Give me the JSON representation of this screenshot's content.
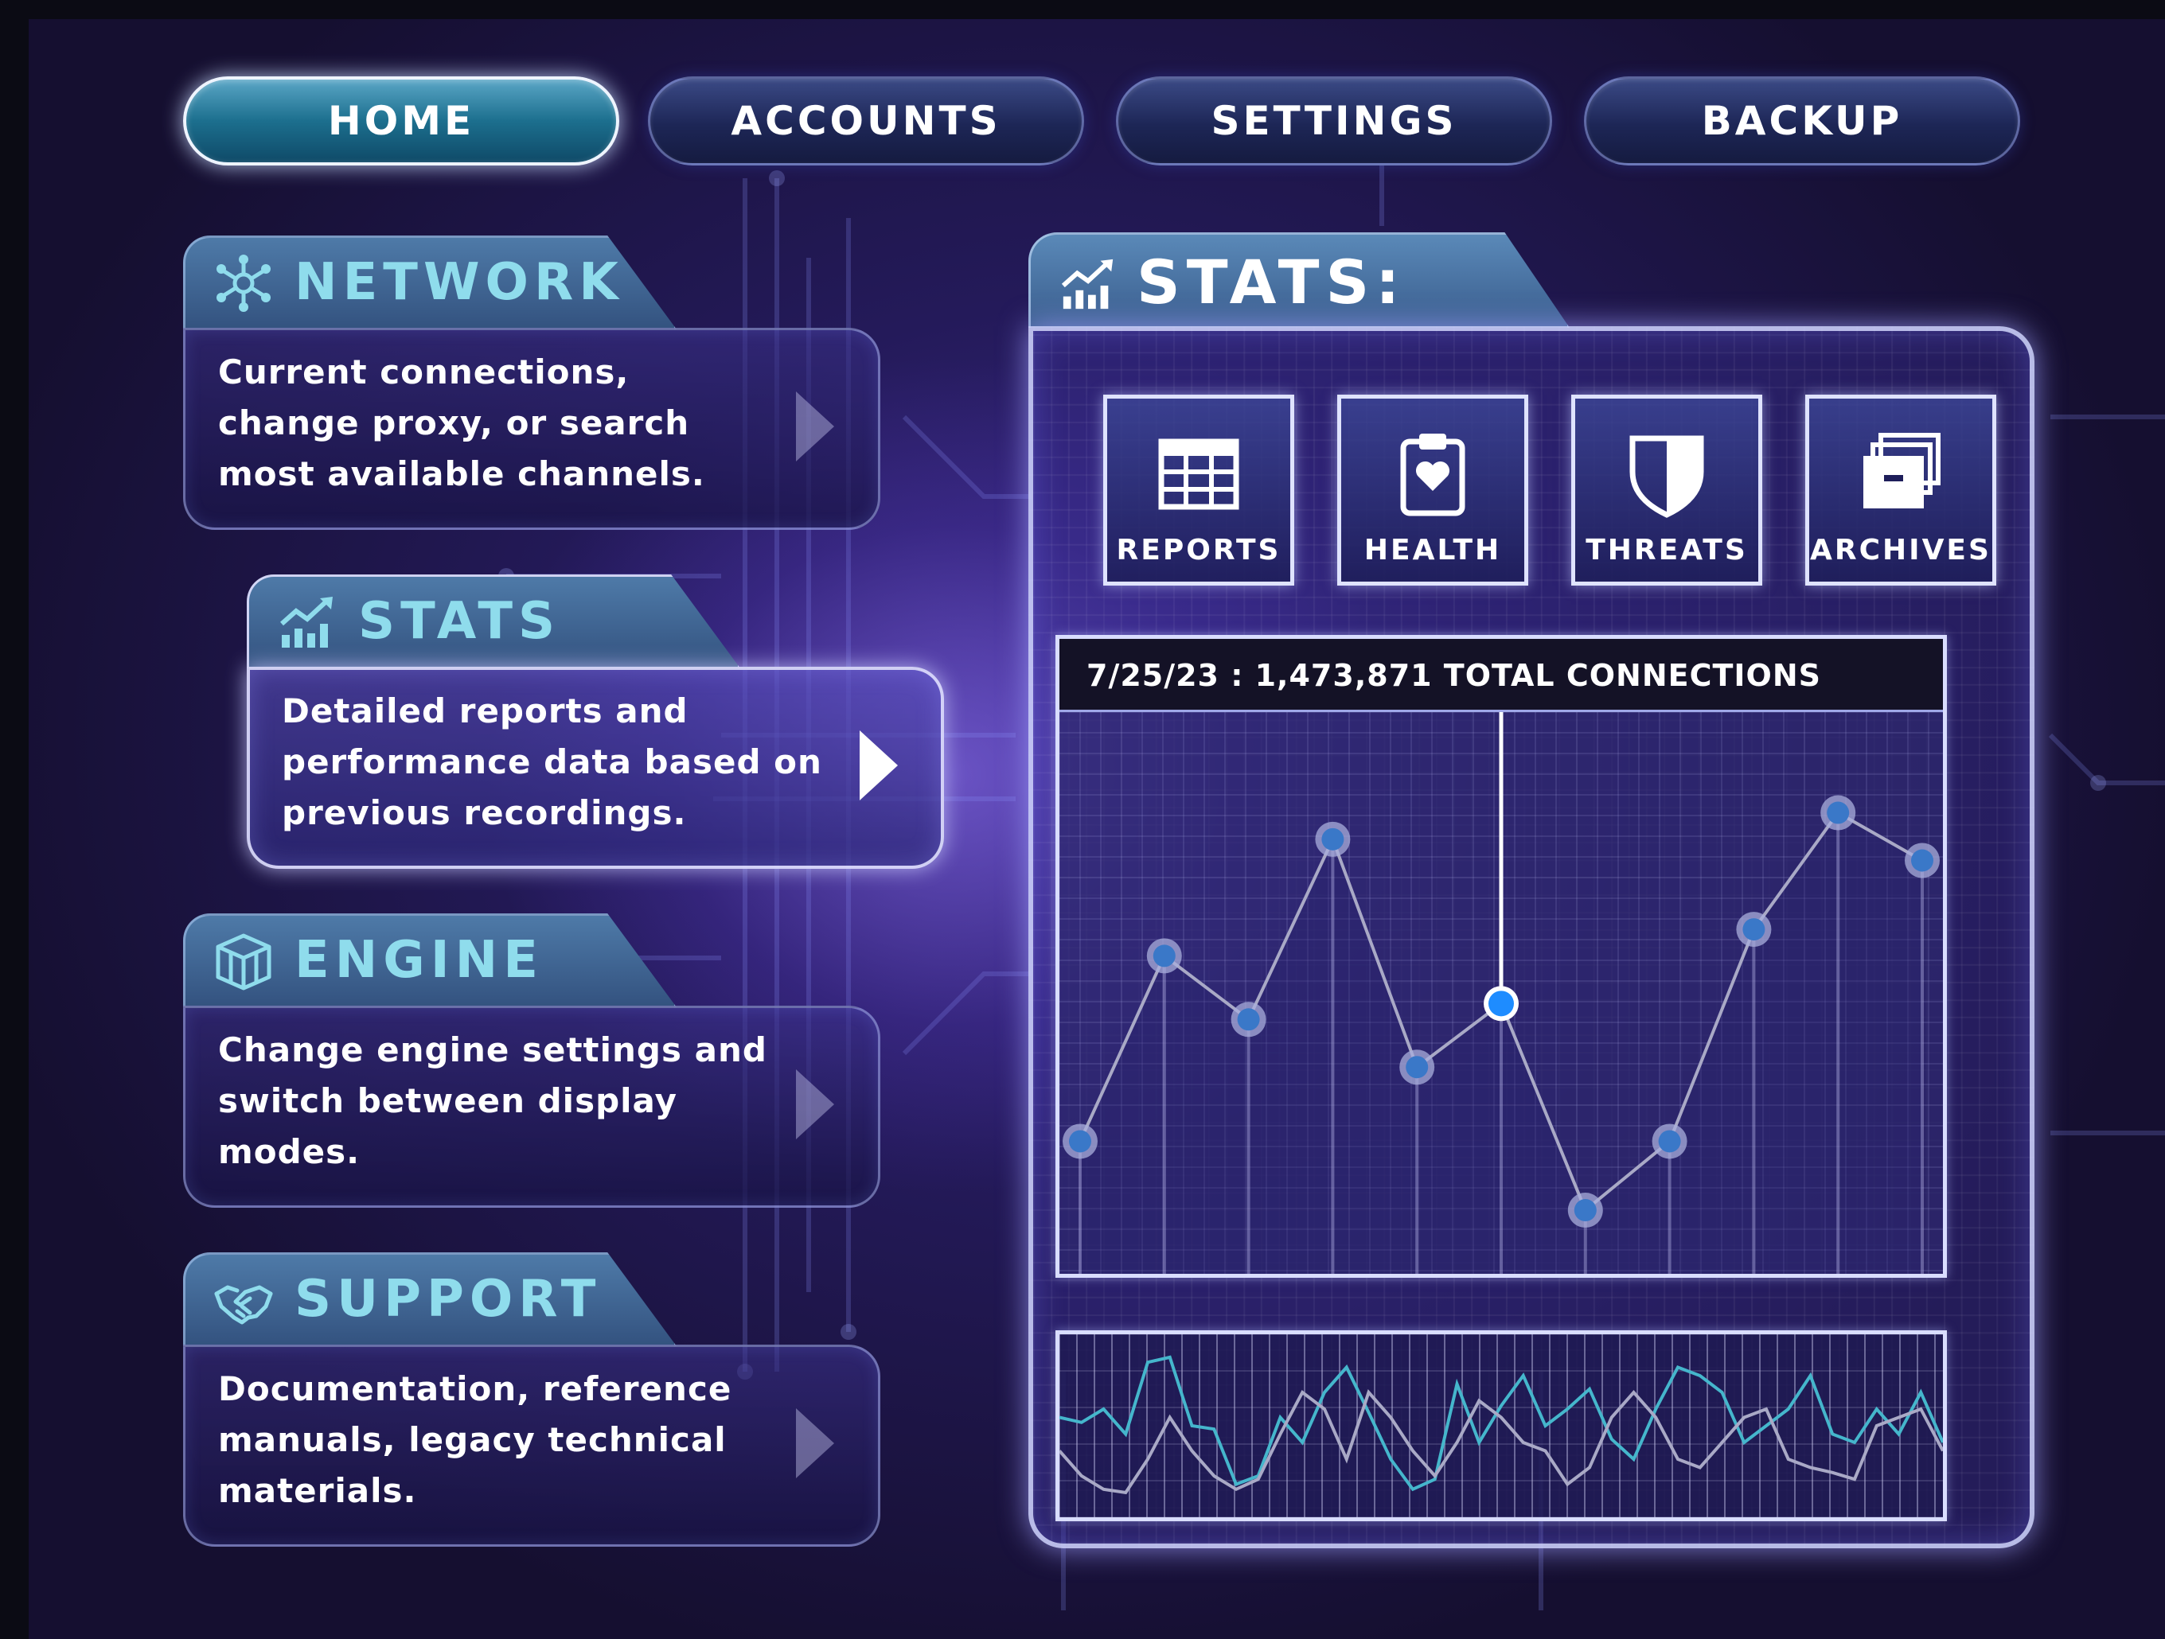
{
  "nav": {
    "tabs": [
      {
        "label": "HOME",
        "active": true
      },
      {
        "label": "ACCOUNTS",
        "active": false
      },
      {
        "label": "SETTINGS",
        "active": false
      },
      {
        "label": "BACKUP",
        "active": false
      }
    ]
  },
  "menu": {
    "network": {
      "title": "NETWORK",
      "description": "Current connections, change proxy, or search most available channels.",
      "icon": "network-icon"
    },
    "stats": {
      "title": "STATS",
      "description": "Detailed reports and performance data based on previous recordings.",
      "icon": "chart-growth-icon",
      "active": true
    },
    "engine": {
      "title": "ENGINE",
      "description": "Change engine settings and switch between display modes.",
      "icon": "engine-cube-icon"
    },
    "support": {
      "title": "SUPPORT",
      "description": "Documentation, reference manuals, legacy technical materials.",
      "icon": "handshake-icon"
    }
  },
  "stats_panel": {
    "title": "STATS:",
    "icon": "chart-growth-icon",
    "buttons": [
      {
        "label": "REPORTS",
        "icon": "table-grid-icon"
      },
      {
        "label": "HEALTH",
        "icon": "clipboard-heart-icon"
      },
      {
        "label": "THREATS",
        "icon": "shield-icon"
      },
      {
        "label": "ARCHIVES",
        "icon": "stacked-boxes-icon"
      }
    ],
    "chart_header": "7/25/23 : 1,473,871 TOTAL CONNECTIONS"
  },
  "colors": {
    "accent_cyan": "#8fdcec",
    "highlight_point": "#1e8cff",
    "point_fill": "#3a78c8",
    "line_gray": "#a9a9c6",
    "line_cyan": "#45b6cc"
  },
  "chart_data": [
    {
      "type": "line",
      "title": "7/25/23 : 1,473,871 TOTAL CONNECTIONS",
      "x": [
        1,
        2,
        3,
        4,
        5,
        6,
        7,
        8,
        9,
        10,
        11
      ],
      "values": [
        22,
        57,
        45,
        79,
        36,
        48,
        9,
        22,
        62,
        84,
        75
      ],
      "ylim": [
        0,
        100
      ],
      "highlighted_index": 5,
      "grid": true
    },
    {
      "type": "line",
      "series": [
        {
          "values": [
            55,
            52,
            60,
            45,
            88,
            91,
            50,
            48,
            15,
            20,
            55,
            40,
            70,
            85,
            58,
            30,
            12,
            18,
            75,
            40,
            62,
            80,
            50,
            60,
            72,
            42,
            30,
            60,
            85,
            80,
            70,
            40,
            50,
            60,
            80,
            45,
            40,
            60,
            45,
            70,
            40
          ]
        },
        {
          "values": [
            35,
            20,
            12,
            10,
            30,
            55,
            35,
            20,
            12,
            18,
            45,
            70,
            60,
            30,
            70,
            55,
            35,
            20,
            40,
            65,
            55,
            40,
            35,
            15,
            25,
            55,
            70,
            55,
            30,
            25,
            40,
            55,
            60,
            30,
            25,
            22,
            18,
            50,
            55,
            60,
            35
          ]
        }
      ],
      "ylim": [
        0,
        100
      ],
      "grid": true
    }
  ]
}
